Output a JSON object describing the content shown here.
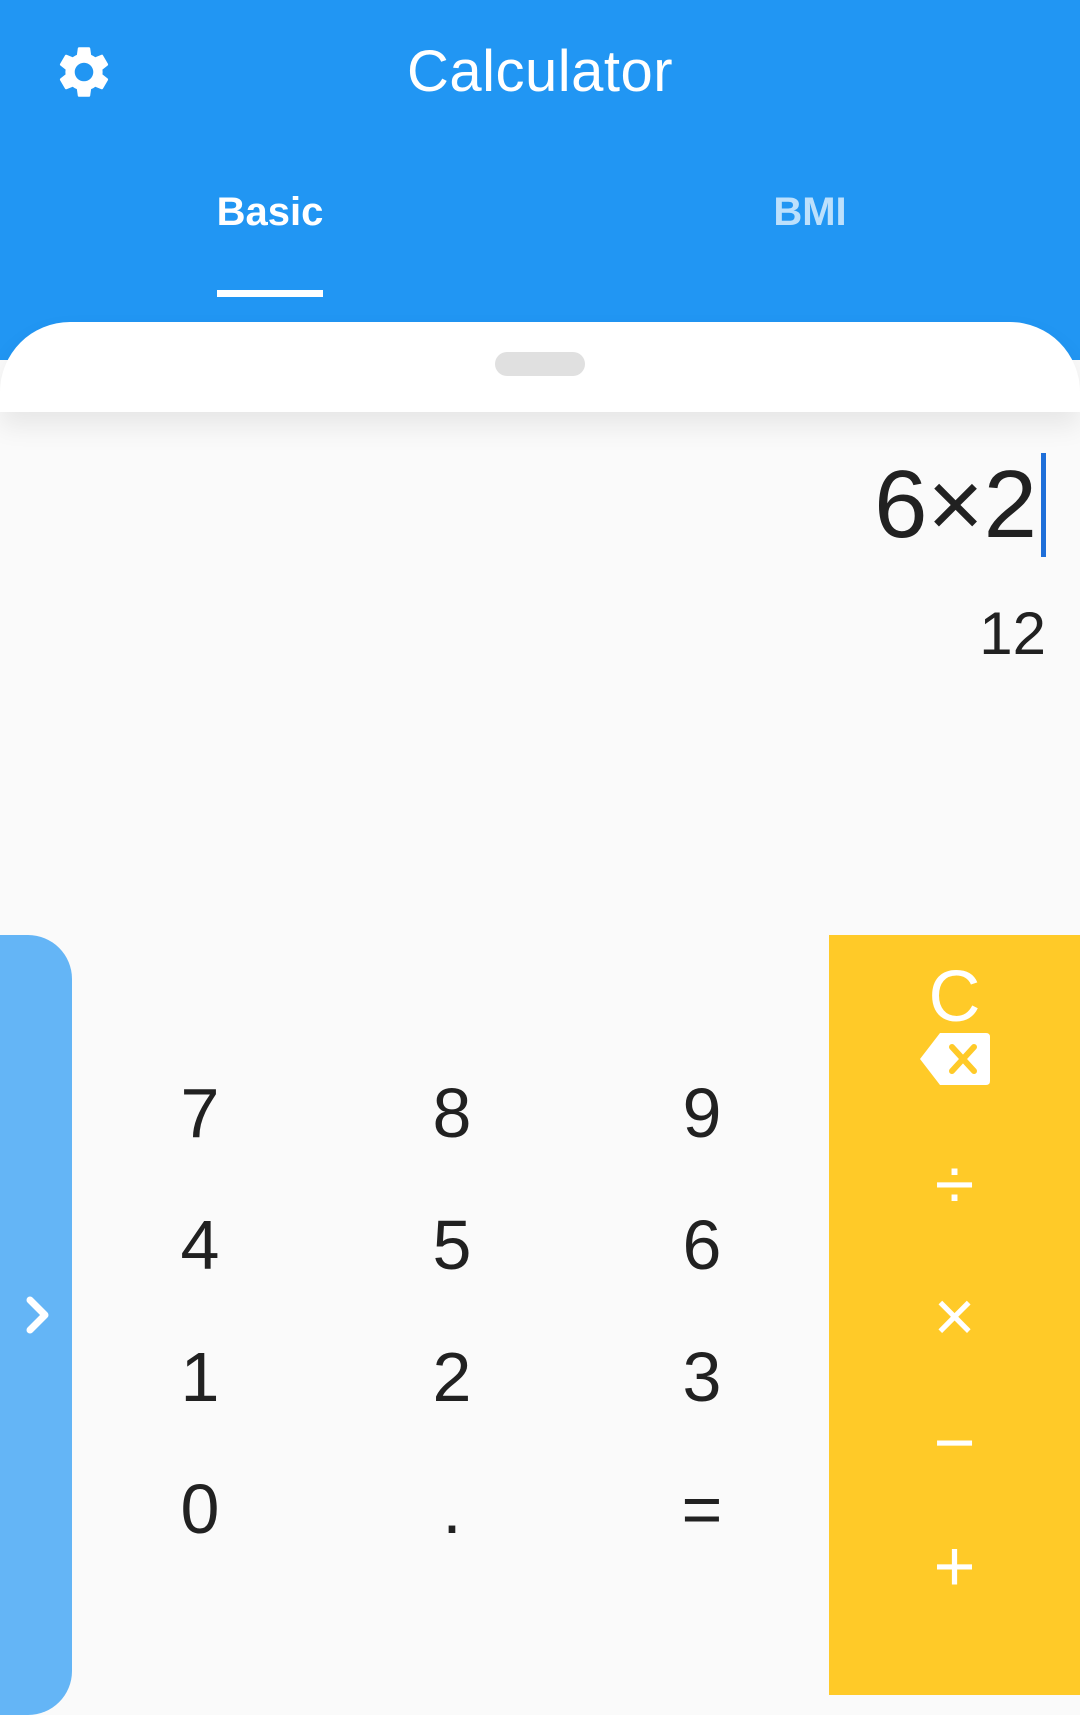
{
  "app_title": "Calculator",
  "icons": {
    "settings": "gear-icon",
    "expand": "chevron-right-icon",
    "backspace": "backspace-icon"
  },
  "tabs": [
    {
      "label": "Basic",
      "selected": true
    },
    {
      "label": "BMI",
      "selected": false
    }
  ],
  "display": {
    "expression": "6×2",
    "result": "12"
  },
  "keypad": {
    "digits": [
      "7",
      "8",
      "9",
      "4",
      "5",
      "6",
      "1",
      "2",
      "3",
      "0",
      ".",
      "="
    ],
    "operators": [
      "C",
      "÷",
      "×",
      "−",
      "+"
    ]
  },
  "colors": {
    "primary": "#2196f3",
    "side_panel": "#64b5f6",
    "accent": "#ffca28",
    "background": "#fafafa",
    "text": "#212121",
    "caret": "#1e6fd9"
  }
}
